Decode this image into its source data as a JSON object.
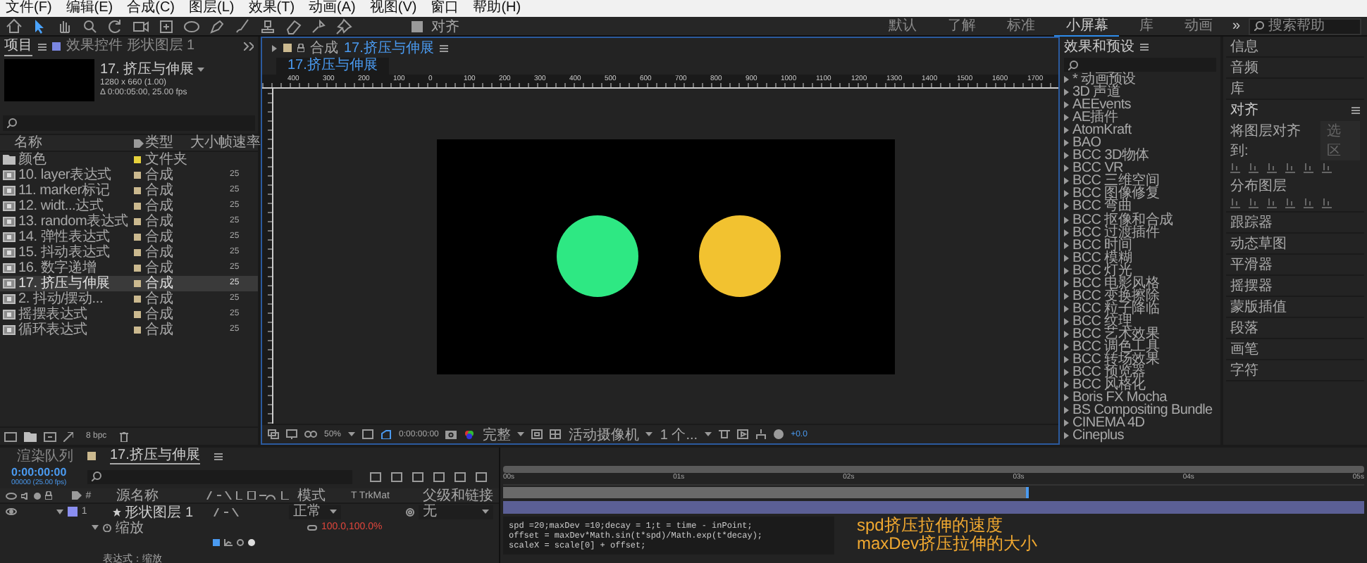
{
  "menu": [
    "文件(F)",
    "编辑(E)",
    "合成(C)",
    "图层(L)",
    "效果(T)",
    "动画(A)",
    "视图(V)",
    "窗口",
    "帮助(H)"
  ],
  "toolbar": {
    "snap": {
      "label": "对齐",
      "checked": true
    },
    "workspaces": [
      {
        "label": "默认",
        "selected": false
      },
      {
        "label": "了解",
        "selected": false
      },
      {
        "label": "标准",
        "selected": false
      },
      {
        "label": "小屏幕",
        "selected": true
      },
      {
        "label": "库",
        "selected": false
      },
      {
        "label": "动画",
        "selected": false
      }
    ],
    "more": "»",
    "search": {
      "placeholder": "搜索帮助"
    }
  },
  "project": {
    "tabs": [
      {
        "label": "项目",
        "selected": true
      },
      {
        "label": "效果控件 形状图层 1",
        "selected": false
      }
    ],
    "comp_name": "17. 挤压与伸展",
    "comp_size": "1280 x 660 (1.00)",
    "comp_duration": "Δ 0:00:05:00, 25.00 fps",
    "columns": [
      "名称",
      "类型",
      "大小",
      "帧速率"
    ],
    "items": [
      {
        "kind": "folder",
        "name": "颜色",
        "color": "#e6d23c",
        "type": "文件夹",
        "selected": false
      },
      {
        "kind": "comp",
        "name": "10. layer表达式",
        "color": "#cbb98f",
        "type": "合成",
        "frame_rate": "25",
        "selected": false
      },
      {
        "kind": "comp",
        "name": "11. marker标记",
        "color": "#cbb98f",
        "type": "合成",
        "frame_rate": "25",
        "selected": false
      },
      {
        "kind": "comp",
        "name": "12. widt...达式",
        "color": "#cbb98f",
        "type": "合成",
        "frame_rate": "25",
        "selected": false
      },
      {
        "kind": "comp",
        "name": "13. random表达式",
        "color": "#cbb98f",
        "type": "合成",
        "frame_rate": "25",
        "selected": false
      },
      {
        "kind": "comp",
        "name": "14. 弹性表达式",
        "color": "#cbb98f",
        "type": "合成",
        "frame_rate": "25",
        "selected": false
      },
      {
        "kind": "comp",
        "name": "15. 抖动表达式",
        "color": "#cbb98f",
        "type": "合成",
        "frame_rate": "25",
        "selected": false
      },
      {
        "kind": "comp",
        "name": "16. 数字递增",
        "color": "#cbb98f",
        "type": "合成",
        "frame_rate": "25",
        "selected": false
      },
      {
        "kind": "comp",
        "name": "17. 挤压与伸展",
        "color": "#cbb98f",
        "type": "合成",
        "frame_rate": "25",
        "selected": true
      },
      {
        "kind": "comp",
        "name": "2. 抖动/摆动...",
        "color": "#cbb98f",
        "type": "合成",
        "frame_rate": "25",
        "selected": false
      },
      {
        "kind": "comp",
        "name": "摇摆表达式",
        "color": "#cbb98f",
        "type": "合成",
        "frame_rate": "25",
        "selected": false
      },
      {
        "kind": "comp",
        "name": "循环表达式",
        "color": "#cbb98f",
        "type": "合成",
        "frame_rate": "25",
        "selected": false
      }
    ],
    "bit_depth": "8 bpc"
  },
  "viewer": {
    "tab_prefix": "合成",
    "tab_title": "17.挤压与伸展",
    "subtab": "17.挤压与伸展",
    "ruler": [
      "400",
      "300",
      "200",
      "100",
      "0",
      "100",
      "200",
      "300",
      "400",
      "500",
      "600",
      "700",
      "800",
      "900",
      "1000",
      "1100",
      "1200",
      "1300",
      "1400",
      "1500",
      "1600",
      "1700"
    ],
    "shapes": [
      {
        "color": "#2ee883"
      },
      {
        "color": "#f2c230"
      }
    ],
    "zoom": "50%",
    "time": "0:00:00:00",
    "resolution": "完整",
    "camera": "活动摄像机",
    "views": "1 个...",
    "exposure": "+0.0"
  },
  "effects": {
    "title": "效果和预设",
    "items": [
      "* 动画预设",
      "3D 声道",
      "AEEvents",
      "AE插件",
      "AtomKraft",
      "BAO",
      "BCC 3D物体",
      "BCC VR",
      "BCC 三维空间",
      "BCC 图像修复",
      "BCC 弯曲",
      "BCC 抠像和合成",
      "BCC 过渡插件",
      "BCC 时间",
      "BCC 模糊",
      "BCC 灯光",
      "BCC 电影风格",
      "BCC 变换擦除",
      "BCC 粒子降临",
      "BCC 纹理",
      "BCC 艺术效果",
      "BCC 调色工具",
      "BCC 转场效果",
      "BCC 预览器",
      "BCC 风格化",
      "Boris FX Mocha",
      "BS Compositing Bundle",
      "CINEMA 4D",
      "Cineplus"
    ]
  },
  "side": [
    {
      "kind": "panel",
      "title": "信息"
    },
    {
      "kind": "panel",
      "title": "音频"
    },
    {
      "kind": "panel",
      "title": "库"
    },
    {
      "kind": "align",
      "title": "对齐",
      "align_to": "将图层对齐到:",
      "align_value": "选区",
      "distribute": "分布图层"
    },
    {
      "kind": "panel",
      "title": "跟踪器"
    },
    {
      "kind": "panel",
      "title": "动态草图"
    },
    {
      "kind": "panel",
      "title": "平滑器"
    },
    {
      "kind": "panel",
      "title": "摇摆器"
    },
    {
      "kind": "panel",
      "title": "蒙版插值"
    },
    {
      "kind": "panel",
      "title": "段落"
    },
    {
      "kind": "panel",
      "title": "画笔"
    },
    {
      "kind": "panel",
      "title": "字符"
    }
  ],
  "timeline": {
    "tabs": [
      {
        "label": "渲染队列",
        "selected": false
      },
      {
        "label": "17.挤压与伸展",
        "selected": true
      }
    ],
    "time": "0:00:00:00",
    "frames": "00000 (25.00 fps)",
    "columns": {
      "index": "#",
      "source": "源名称",
      "mode": "模式",
      "trkmat": "T  TrkMat",
      "parent": "父级和链接"
    },
    "layers": [
      {
        "index": "1",
        "name": "形状图层 1",
        "color": "#8a8ef0",
        "mode": "正常",
        "parent": "无",
        "expanded": true,
        "property": {
          "name": "缩放",
          "value": "100.0,100.0%"
        }
      }
    ],
    "expression_label": "表达式：缩放",
    "ruler": [
      "00s",
      "01s",
      "02s",
      "03s",
      "04s",
      "05s"
    ],
    "code": [
      "spd =20;maxDev =10;decay = 1;t = time - inPoint;",
      "offset = maxDev*Math.sin(t*spd)/Math.exp(t*decay);",
      "scaleX = scale[0] + offset;"
    ],
    "notes": [
      "spd挤压拉伸的速度",
      "maxDev挤压拉伸的大小"
    ]
  }
}
